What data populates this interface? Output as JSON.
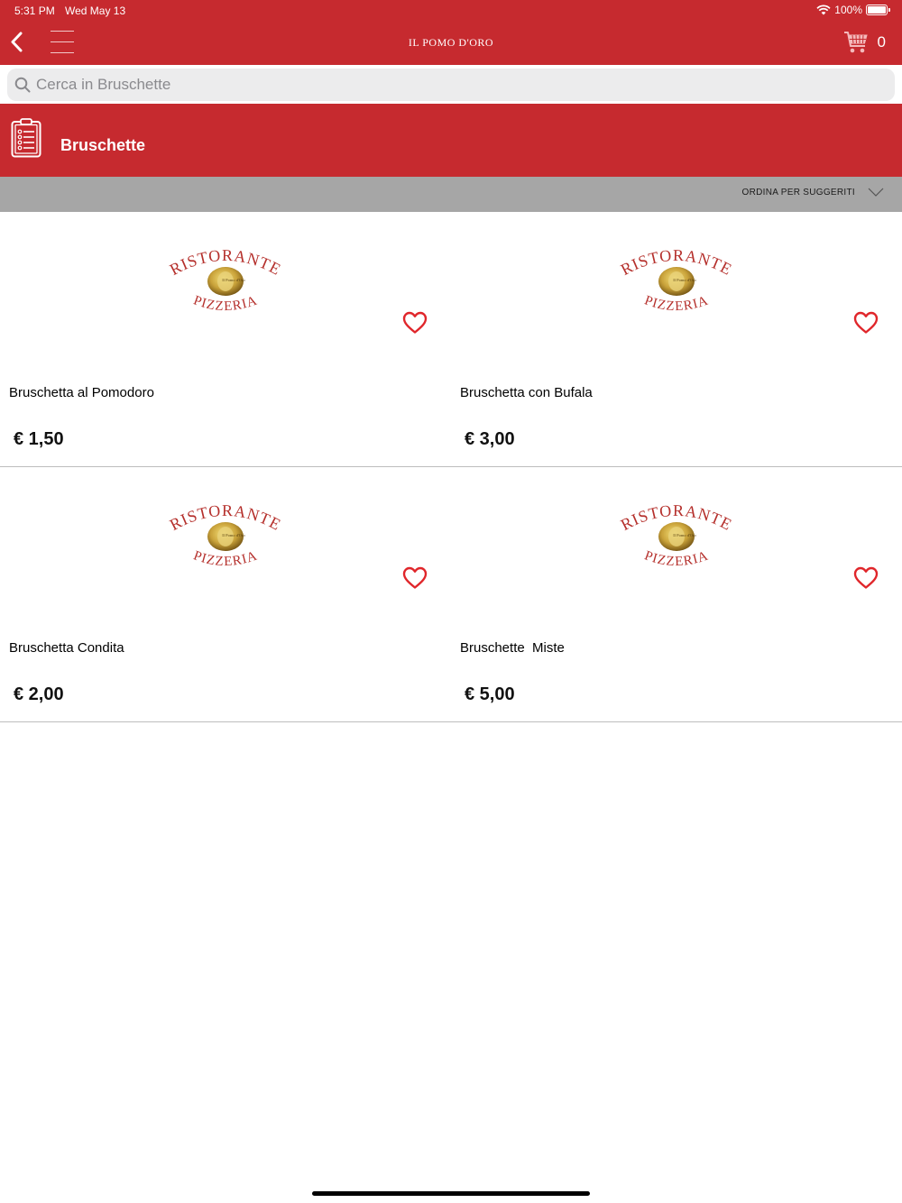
{
  "status": {
    "time": "5:31 PM",
    "date": "Wed May 13",
    "battery": "100%"
  },
  "header": {
    "title": "IL POMO D'ORO",
    "cart_count": "0"
  },
  "search": {
    "placeholder": "Cerca in Bruschette",
    "value": ""
  },
  "category": {
    "title": "Bruschette"
  },
  "sort": {
    "label": "ORDINA PER SUGGERITI"
  },
  "logo": {
    "top_text": "RISTORANTE",
    "bottom_text": "PIZZERIA",
    "medallion_text": "Il Pomo d'Oro"
  },
  "products": [
    {
      "name": "Bruschetta al Pomodoro",
      "price": "€ 1,50"
    },
    {
      "name": "Bruschetta con Bufala",
      "price": "€ 3,00"
    },
    {
      "name": "Bruschetta Condita",
      "price": "€ 2,00"
    },
    {
      "name": "Bruschette  Miste",
      "price": "€ 5,00"
    }
  ],
  "colors": {
    "brand_red": "#c62a2f",
    "sort_bar": "#a6a6a6",
    "heart": "#e0262b",
    "logo_text": "#b5302c",
    "gold": "#c9a23a"
  }
}
